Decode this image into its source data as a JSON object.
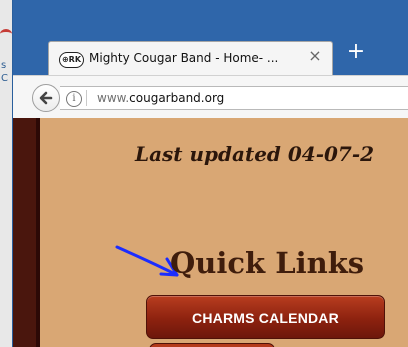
{
  "background_window": {
    "fragment_1": "s",
    "fragment_2": "C"
  },
  "browser": {
    "tab": {
      "favicon_text": "⊕RK",
      "title": "Mighty Cougar Band - Home- ...",
      "close_symbol": "×"
    },
    "new_tab_symbol": "+",
    "address_bar": {
      "prefix": "www.",
      "domain": "cougarband.org"
    }
  },
  "page": {
    "last_updated": "Last updated 04-07-2",
    "quick_links_title": "Quick Links",
    "buttons": {
      "charms_calendar": "CHARMS CALENDAR"
    }
  },
  "colors": {
    "browser_chrome": "#2f66aa",
    "page_background": "#d9a774",
    "left_rail": "#4a160d",
    "button_red": "#8d220f",
    "annotation_blue": "#1b2cff"
  }
}
